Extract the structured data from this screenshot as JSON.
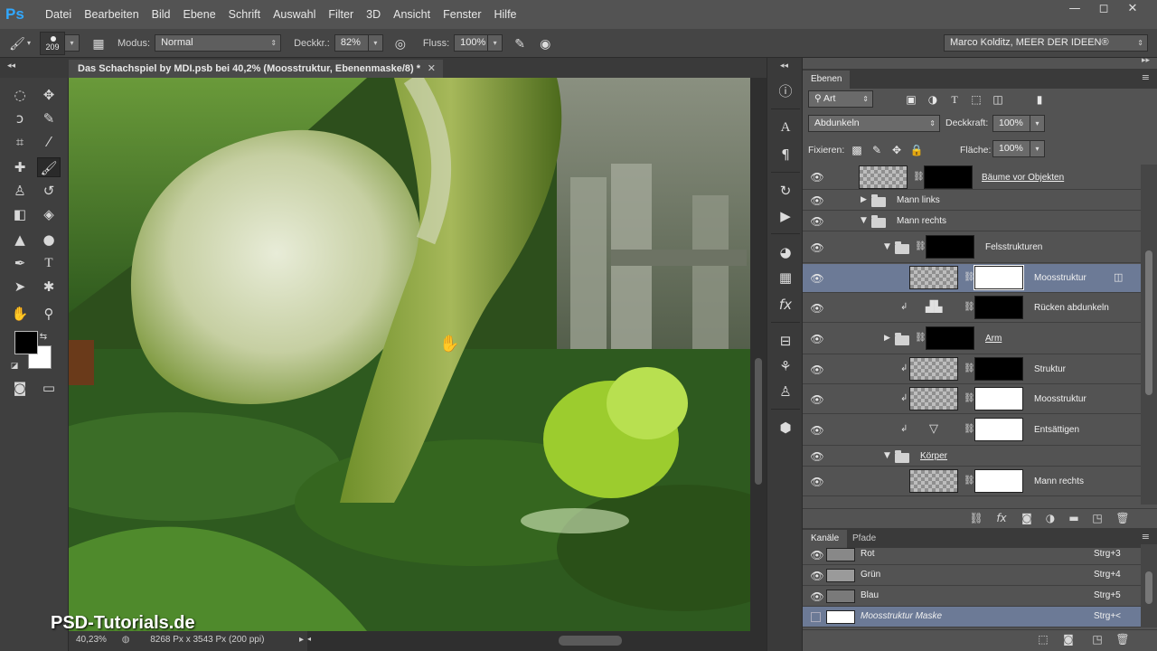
{
  "app": {
    "logo": "Ps"
  },
  "menu": [
    "Datei",
    "Bearbeiten",
    "Bild",
    "Ebene",
    "Schrift",
    "Auswahl",
    "Filter",
    "3D",
    "Ansicht",
    "Fenster",
    "Hilfe"
  ],
  "window_buttons": [
    "—",
    "◻",
    "✕"
  ],
  "options": {
    "brush_size": "209",
    "modus_label": "Modus:",
    "modus_value": "Normal",
    "deckkr_label": "Deckkr.:",
    "deckkr_value": "82%",
    "fluss_label": "Fluss:",
    "fluss_value": "100%",
    "workspace": "Marco Kolditz, MEER DER IDEEN®"
  },
  "document": {
    "tab_title": "Das Schachspiel by MDI.psb bei 40,2% (Moosstruktur, Ebenenmaske/8) *",
    "close": "✕"
  },
  "status": {
    "zoom": "40,23%",
    "size": "8268 Px x 3543 Px (200 ppi)"
  },
  "watermark": "PSD-Tutorials.de",
  "layers_panel": {
    "tab": "Ebenen",
    "filter_label": "Art",
    "blend_mode": "Abdunkeln",
    "opacity_label": "Deckkraft:",
    "opacity_value": "100%",
    "lock_label": "Fixieren:",
    "fill_label": "Fläche:",
    "fill_value": "100%",
    "layers": [
      {
        "name": "Bäume vor Objekten",
        "type": "smart"
      },
      {
        "name": "Mann links",
        "type": "group"
      },
      {
        "name": "Mann rechts",
        "type": "group"
      },
      {
        "name": "Felsstrukturen",
        "type": "group"
      },
      {
        "name": "Moosstruktur",
        "type": "smart"
      },
      {
        "name": "Rücken abdunkeln",
        "type": "adjustment"
      },
      {
        "name": "Arm",
        "type": "group"
      },
      {
        "name": "Struktur",
        "type": "smart"
      },
      {
        "name": "Moosstruktur",
        "type": "smart"
      },
      {
        "name": "Entsättigen",
        "type": "adjustment"
      },
      {
        "name": "Körper",
        "type": "group"
      },
      {
        "name": "Mann rechts",
        "type": "smart"
      }
    ]
  },
  "channels_panel": {
    "tabs": [
      "Kanäle",
      "Pfade"
    ],
    "channels": [
      {
        "name": "Rot",
        "shortcut": "Strg+3"
      },
      {
        "name": "Grün",
        "shortcut": "Strg+4"
      },
      {
        "name": "Blau",
        "shortcut": "Strg+5"
      },
      {
        "name": "Moosstruktur Maske",
        "shortcut": "Strg+<"
      }
    ]
  },
  "colors": {
    "selection": "#6c7a96",
    "panel_bg": "#535353",
    "menubar_bg": "#535353",
    "ps_blue": "#31a8ff"
  }
}
